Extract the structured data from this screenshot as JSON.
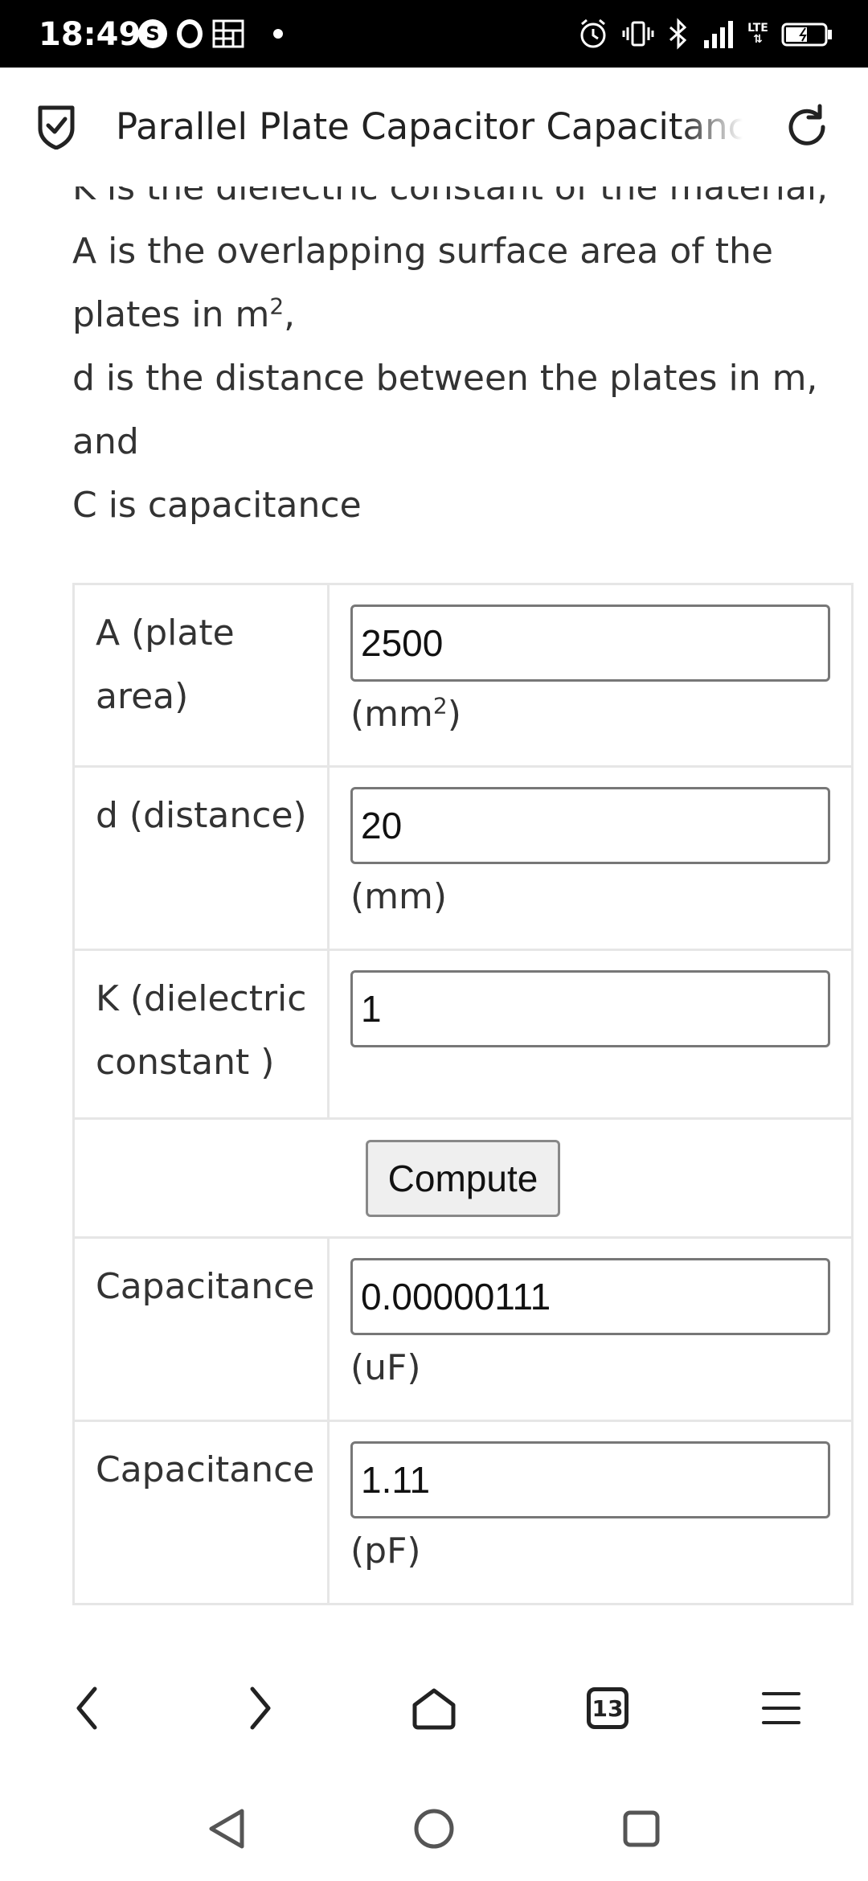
{
  "status_bar": {
    "time": "18:49",
    "network_label": "LTE",
    "icons": [
      "skype-icon",
      "ring-icon",
      "app-glyph-icon",
      "alarm-icon",
      "vibrate-icon",
      "bluetooth-icon",
      "signal-icon",
      "battery-icon"
    ]
  },
  "browser": {
    "page_title": "Parallel Plate Capacitor Capacitance",
    "tab_count": "13"
  },
  "description": {
    "line_k": "K is the dielectric constant of the material,",
    "line_a_prefix": "A is the overlapping surface area of the plates in m",
    "line_a_sup": "2",
    "line_a_suffix": ",",
    "line_d": "d is the distance between the plates in m, and",
    "line_c": "C is capacitance"
  },
  "calculator": {
    "area": {
      "label": "A (plate area)",
      "value": "2500",
      "unit_prefix": "(mm",
      "unit_sup": "2",
      "unit_suffix": ")"
    },
    "distance": {
      "label": "d (distance)",
      "value": "20",
      "unit": "(mm)"
    },
    "dielectric": {
      "label": "K (dielectric constant )",
      "value": "1"
    },
    "compute_label": "Compute",
    "cap_uf": {
      "label": "Capacitance",
      "value": "0.00000111",
      "unit": "(uF)"
    },
    "cap_pf": {
      "label": "Capacitance",
      "value": "1.11",
      "unit": "(pF)"
    }
  },
  "colors": {
    "status_bar_bg": "#000000",
    "page_bg": "#ffffff",
    "table_border": "#e6e6e6",
    "button_bg": "#efefef"
  }
}
